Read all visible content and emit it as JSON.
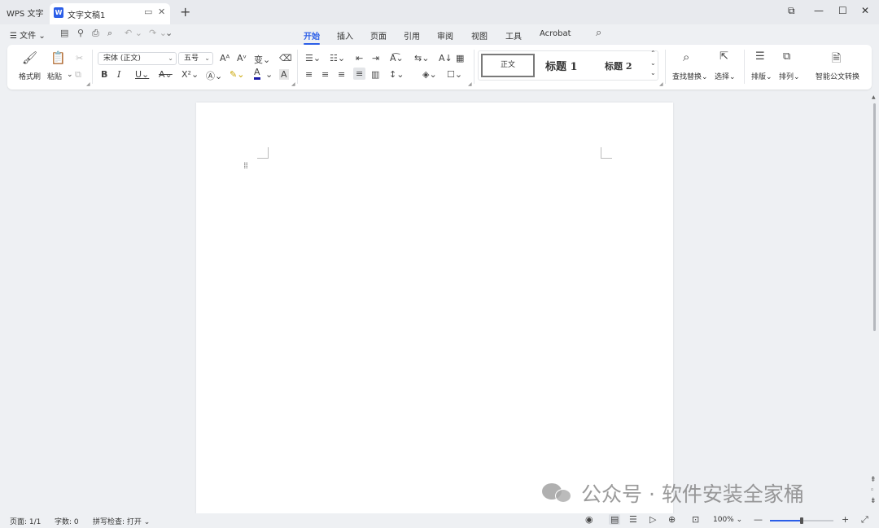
{
  "titlebar": {
    "app_name": "WPS 文字",
    "doc_tab": {
      "icon": "W",
      "title": "文字文稿1"
    },
    "new_tab": "+",
    "window_controls": {
      "restore_tabs": "⧉",
      "minimize": "—",
      "maximize": "☐",
      "close": "✕"
    }
  },
  "menubar": {
    "file_label": "☰ 文件 ⌄",
    "tabs": [
      {
        "label": "开始",
        "active": true
      },
      {
        "label": "插入"
      },
      {
        "label": "页面"
      },
      {
        "label": "引用"
      },
      {
        "label": "审阅"
      },
      {
        "label": "视图"
      },
      {
        "label": "工具"
      },
      {
        "label": "Acrobat"
      }
    ]
  },
  "ribbon": {
    "format_painter": "格式刷",
    "paste": "粘贴",
    "font_family": "宋体 (正文)",
    "font_size": "五号",
    "style_normal": "正文",
    "style_heading1": "标题 1",
    "style_heading2": "标题 2",
    "find_replace": "查找替换",
    "select": "选择",
    "layout": "排版",
    "arrange": "排列",
    "smart_doc": "智能公文转换"
  },
  "watermark": {
    "text": "公众号 · 软件安装全家桶"
  },
  "statusbar": {
    "page": "页面: 1/1",
    "words": "字数: 0",
    "spellcheck": "拼写检查: 打开",
    "zoom": "100%",
    "zoom_fraction": 0.5
  },
  "accent_color": "#2b5ee8"
}
